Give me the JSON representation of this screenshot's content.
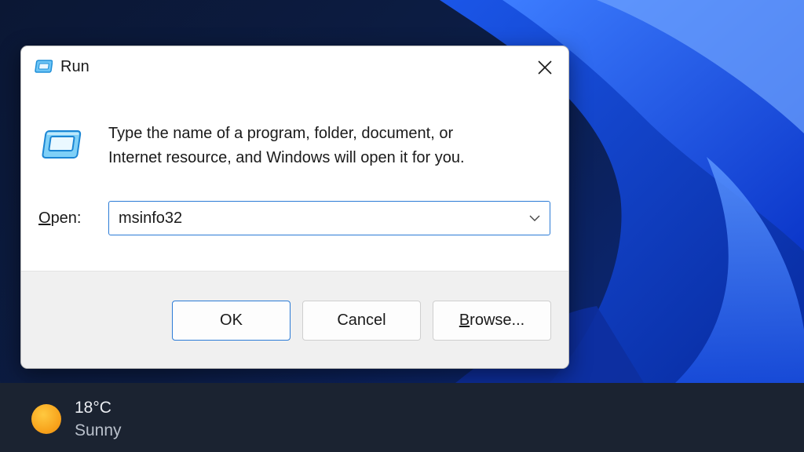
{
  "dialog": {
    "title": "Run",
    "description_line1": "Type the name of a program, folder, document, or",
    "description_line2": "Internet resource, and Windows will open it for you.",
    "open_label_underlined": "O",
    "open_label_rest": "pen:",
    "open_value": "msinfo32",
    "buttons": {
      "ok": "OK",
      "cancel": "Cancel",
      "browse_underlined": "B",
      "browse_rest": "rowse..."
    }
  },
  "taskbar": {
    "weather": {
      "temperature": "18°C",
      "condition": "Sunny",
      "icon": "sun-icon"
    }
  },
  "colors": {
    "accent": "#2b7bd6",
    "taskbar": "#1b2331",
    "wallpaper_blue": "#1f5cf0",
    "sun": "#f7a21b"
  }
}
